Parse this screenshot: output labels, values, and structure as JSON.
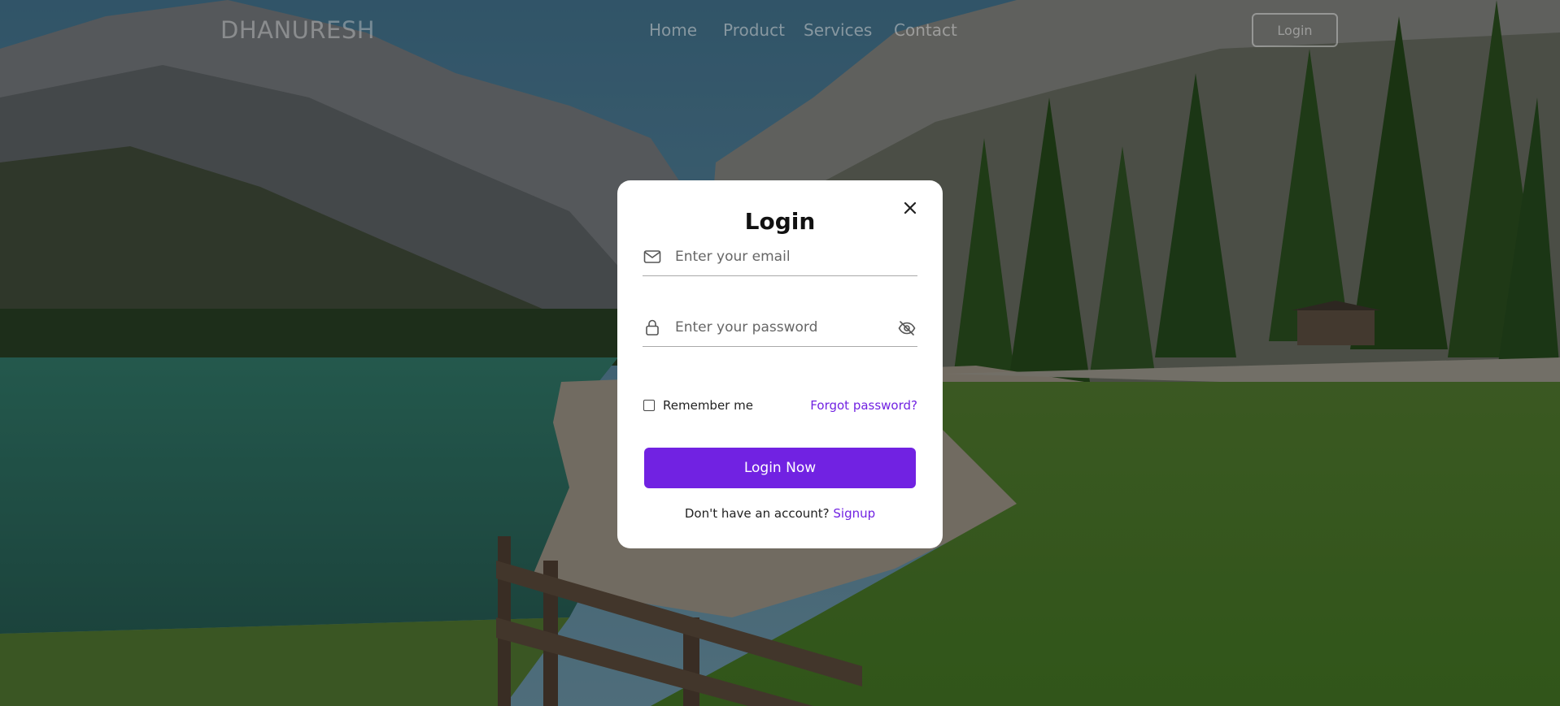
{
  "navbar": {
    "logo": "DHANURESH",
    "links": [
      "Home",
      "Product",
      "Services",
      "Contact"
    ],
    "login_button": "Login"
  },
  "modal": {
    "title": "Login",
    "email_placeholder": "Enter your email",
    "password_placeholder": "Enter your password",
    "remember_label": "Remember me",
    "forgot_link": "Forgot password?",
    "submit_label": "Login Now",
    "signup_prompt": "Don't have an account?",
    "signup_link": "Signup",
    "icons": {
      "close": "close-icon",
      "email": "envelope-icon",
      "password": "lock-icon",
      "toggle_visibility": "eye-off-icon"
    }
  },
  "colors": {
    "accent": "#7122e2",
    "overlay": "rgba(0,0,0,0.38)",
    "modal_bg": "#ffffff"
  }
}
